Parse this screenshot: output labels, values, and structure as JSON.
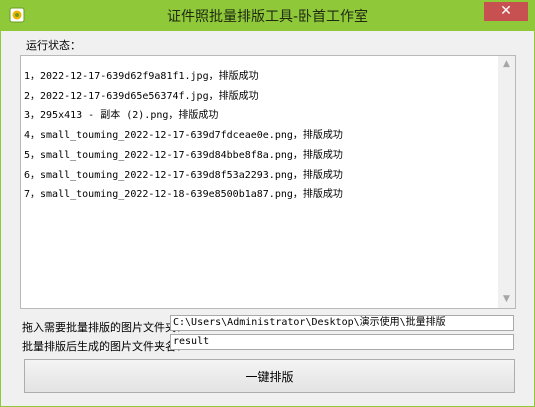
{
  "window": {
    "title": "证件照批量排版工具-卧首工作室",
    "close_glyph": "✕"
  },
  "status_label": "运行状态：",
  "log_lines": [
    "1，2022-12-17-639d62f9a81f1.jpg，排版成功",
    "2，2022-12-17-639d65e56374f.jpg，排版成功",
    "3，295x413 - 副本 (2).png，排版成功",
    "4，small_touming_2022-12-17-639d7fdceae0e.png，排版成功",
    "5，small_touming_2022-12-17-639d84bbe8f8a.png，排版成功",
    "6，small_touming_2022-12-17-639d8f53a2293.png，排版成功",
    "7，small_touming_2022-12-18-639e8500b1a87.png，排版成功"
  ],
  "source_folder": {
    "label": "拖入需要批量排版的图片文件夹：",
    "value": "C:\\Users\\Administrator\\Desktop\\演示使用\\批量排版"
  },
  "output_folder": {
    "label": "批量排版后生成的图片文件夹名：",
    "value": "result"
  },
  "run_button": "一键排版",
  "colors": {
    "title_bar": "#8fc93a",
    "close_button": "#c75050"
  }
}
